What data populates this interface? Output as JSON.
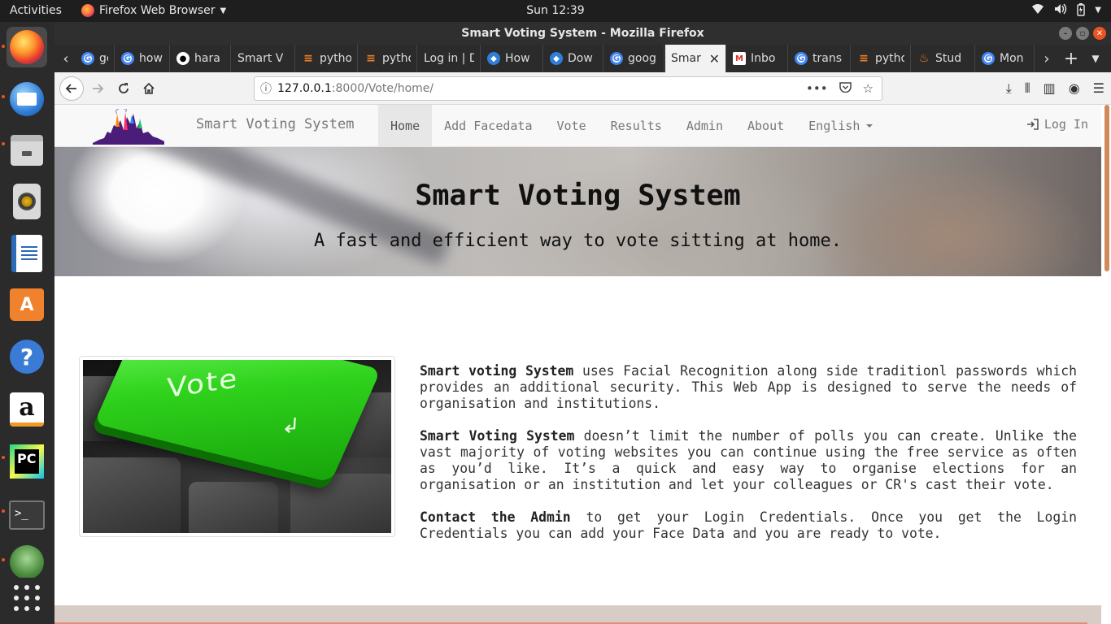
{
  "system": {
    "activities": "Activities",
    "app_menu": "Firefox Web Browser",
    "clock": "Sun 12:39"
  },
  "dock": [
    "firefox-icon",
    "thunderbird-icon",
    "files-icon",
    "rhythmbox-icon",
    "writer-icon",
    "software-icon",
    "help-icon",
    "amazon-icon",
    "pycharm-icon",
    "terminal-icon",
    "app-icon",
    "show-apps-icon"
  ],
  "window": {
    "title": "Smart Voting System - Mozilla Firefox"
  },
  "tabs": [
    {
      "label": "goog",
      "icon": "google"
    },
    {
      "label": "how",
      "icon": "google"
    },
    {
      "label": "hara",
      "icon": "github"
    },
    {
      "label": "Smart V",
      "icon": "none"
    },
    {
      "label": "pytho",
      "icon": "stackoverflow"
    },
    {
      "label": "pytho",
      "icon": "stackoverflow"
    },
    {
      "label": "Log in | D",
      "icon": "none"
    },
    {
      "label": "How",
      "icon": "blue"
    },
    {
      "label": "Dow",
      "icon": "blue"
    },
    {
      "label": "goog",
      "icon": "google"
    },
    {
      "label": "Smar",
      "icon": "none",
      "active": true
    },
    {
      "label": "Inbo",
      "icon": "gmail"
    },
    {
      "label": "trans",
      "icon": "google"
    },
    {
      "label": "pytho",
      "icon": "stackoverflow"
    },
    {
      "label": "Stud",
      "icon": "fire"
    },
    {
      "label": "Mon",
      "icon": "google"
    }
  ],
  "url": {
    "host": "127.0.0.1",
    "rest": ":8000/Vote/home/"
  },
  "site": {
    "brand": "Smart Voting System",
    "menu": [
      "Home",
      "Add Facedata",
      "Vote",
      "Results",
      "Admin",
      "About",
      "English"
    ],
    "login": "Log In",
    "hero_title": "Smart Voting System",
    "hero_subtitle": "A fast and efficient way to vote sitting at home.",
    "image_text": "Vote",
    "para1_bold": "Smart voting System",
    "para1": " uses Facial Recognition along side traditionl passwords which provides an additional security. This Web App is designed to serve the needs of organisation and institutions.",
    "para2_bold": "Smart Voting System",
    "para2": " doesn’t limit the number of polls you can create. Unlike the vast majority of voting websites you can continue using the free service as often as you’d like. It’s a quick and easy way to organise elections for an organisation or an institution and let your colleagues or CR's cast their vote.",
    "para3_bold": "Contact the Admin",
    "para3": " to get your Login Credentials. Once you get the Login Credentials you can add your Face Data and you are ready to vote."
  },
  "colors": {
    "ubuntu_orange": "#e95420",
    "vote_key_green": "#2fd21c"
  }
}
